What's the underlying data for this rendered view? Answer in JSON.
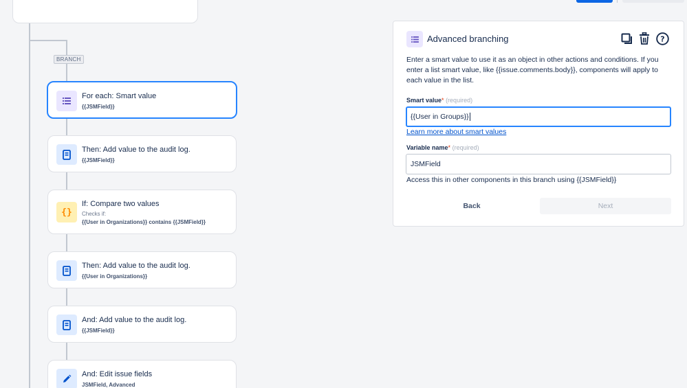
{
  "branch": {
    "tag": "BRANCH"
  },
  "cards": [
    {
      "title": "For each: Smart value",
      "sub": "{{JSMField}}",
      "icon": "list-icon"
    },
    {
      "title": "Then: Add value to the audit log.",
      "sub": "{{JSMField}}",
      "icon": "document-icon"
    },
    {
      "title": "If: Compare two values",
      "small": "Checks if:",
      "sub": "{{User in Organizations}} contains {{JSMField}}",
      "icon": "braces-icon"
    },
    {
      "title": "Then: Add value to the audit log.",
      "sub": "{{User in Organizations}}",
      "icon": "document-icon"
    },
    {
      "title": "And: Add value to the audit log.",
      "sub": "{{JSMField}}",
      "icon": "document-icon"
    },
    {
      "title": "And: Edit issue fields",
      "sub": "JSMField, Advanced",
      "icon": "pencil-icon"
    }
  ],
  "panel": {
    "title": "Advanced branching",
    "description": "Enter a smart value to use it as an object in other actions and conditions. If you enter a list smart value, like {{issue.comments.body}}, components will apply to each value in the list.",
    "smart_value": {
      "label": "Smart value",
      "required_mark": "*",
      "hint": "(required)",
      "value": "{{User in Groups}}"
    },
    "learn_more": "Learn more about smart values",
    "variable_name": {
      "label": "Variable name",
      "required_mark": "*",
      "hint": "(required)",
      "value": "JSMField"
    },
    "helper": "Access this in other components in this branch using {{JSMField}}",
    "back_label": "Back",
    "next_label": "Next"
  },
  "colors": {
    "accent": "#2684ff",
    "primary": "#0c66e4",
    "purple": "#6554c0",
    "blue": "#0052cc",
    "yellow": "#ff8b00"
  }
}
